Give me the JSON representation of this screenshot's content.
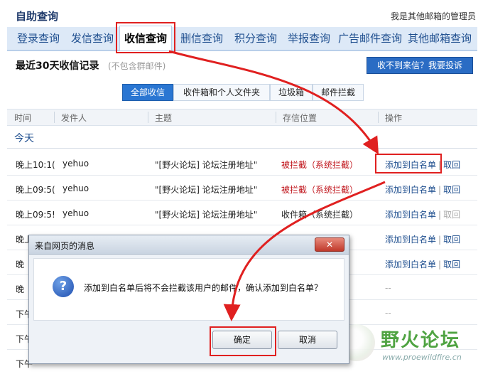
{
  "header": {
    "title": "自助查询",
    "admin": "我是其他邮箱的管理员"
  },
  "tabs": [
    "登录查询",
    "发信查询",
    "收信查询",
    "删信查询",
    "积分查询",
    "举报查询",
    "广告邮件查询",
    "其他邮箱查询"
  ],
  "active_tab": "收信查询",
  "section": {
    "heading": "最近30天收信记录",
    "note": "(不包含群邮件)",
    "complain_button": "收不到来信？我要投诉"
  },
  "filters": [
    "全部收信",
    "收件箱和个人文件夹",
    "垃圾箱",
    "邮件拦截"
  ],
  "columns": [
    "时间",
    "发件人",
    "主题",
    "存信位置",
    "操作"
  ],
  "group_label": "今天",
  "rows": [
    {
      "time": "晚上10:1(",
      "sender": "yehuo",
      "subject": "\"[野火论坛] 论坛注册地址\"",
      "location": "被拦截（系统拦截）",
      "action": "添加到白名单",
      "sep": "|",
      "undo": "取回"
    },
    {
      "time": "晚上09:5(",
      "sender": "yehuo",
      "subject": "\"[野火论坛] 论坛注册地址\"",
      "location": "被拦截（系统拦截）",
      "action": "添加到白名单",
      "sep": "|",
      "undo": "取回"
    },
    {
      "time": "晚上09:5!",
      "sender": "yehuo",
      "subject": "\"[野火论坛] 论坛注册地址\"",
      "location": "收件箱（系统拦截）",
      "action": "添加到白名单",
      "sep": "|",
      "undo": "取回"
    },
    {
      "time": "晚上",
      "action": "添加到白名单",
      "sep": "|",
      "undo": "取回"
    },
    {
      "time": "晚",
      "action": "添加到白名单",
      "sep": "|",
      "undo": "取回"
    },
    {
      "time": "晚",
      "dash": "--"
    },
    {
      "time": "下午",
      "dash": "--"
    },
    {
      "time": "下午"
    },
    {
      "time": "下午"
    }
  ],
  "dialog": {
    "title": "来自网页的消息",
    "message": "添加到白名单后将不会拦截该用户的邮件，确认添加到白名单？",
    "ok": "确定",
    "cancel": "取消"
  },
  "watermark": {
    "name": "野火论坛",
    "url": "www.proewildfire.cn"
  },
  "colors": {
    "accent": "#2a6cc4",
    "highlight": "#e02020",
    "blocked": "#c0141b"
  }
}
